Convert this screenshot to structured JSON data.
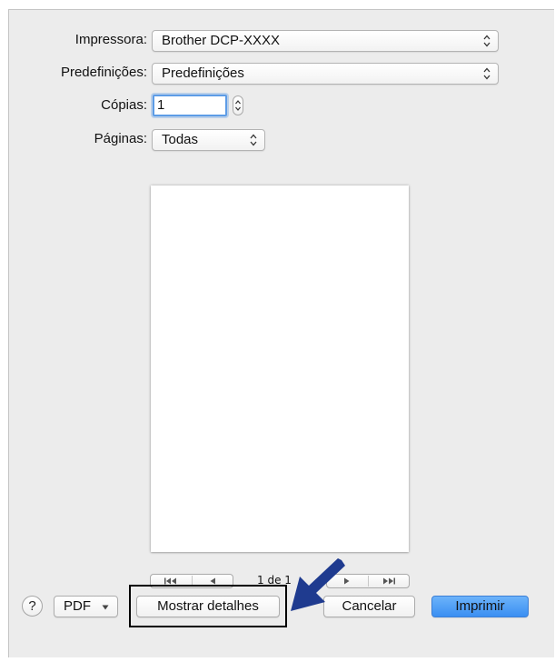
{
  "printer": {
    "label": "Impressora:",
    "value": "Brother DCP-XXXX"
  },
  "presets": {
    "label": "Predefinições:",
    "value": "Predefinições"
  },
  "copies": {
    "label": "Cópias:",
    "value": "1"
  },
  "pages": {
    "label": "Páginas:",
    "value": "Todas"
  },
  "navigation": {
    "page_indicator": "1 de 1"
  },
  "footer": {
    "help_label": "?",
    "pdf_label": "PDF",
    "show_details_label": "Mostrar detalhes",
    "cancel_label": "Cancelar",
    "print_label": "Imprimir"
  },
  "colors": {
    "dialog_bg": "#ececec",
    "primary_button": "#3a8ff2",
    "focus_ring": "#5d9ce6",
    "annotation_arrow": "#1f3b8f"
  },
  "icons": {
    "popup_arrows": "up-down-chevron-icon",
    "first_page": "first-page-icon",
    "prev_page": "previous-page-icon",
    "next_page": "next-page-icon",
    "last_page": "last-page-icon",
    "help": "help-icon",
    "pdf_menu": "dropdown-triangle-icon",
    "annotation": "pointer-arrow-icon"
  }
}
